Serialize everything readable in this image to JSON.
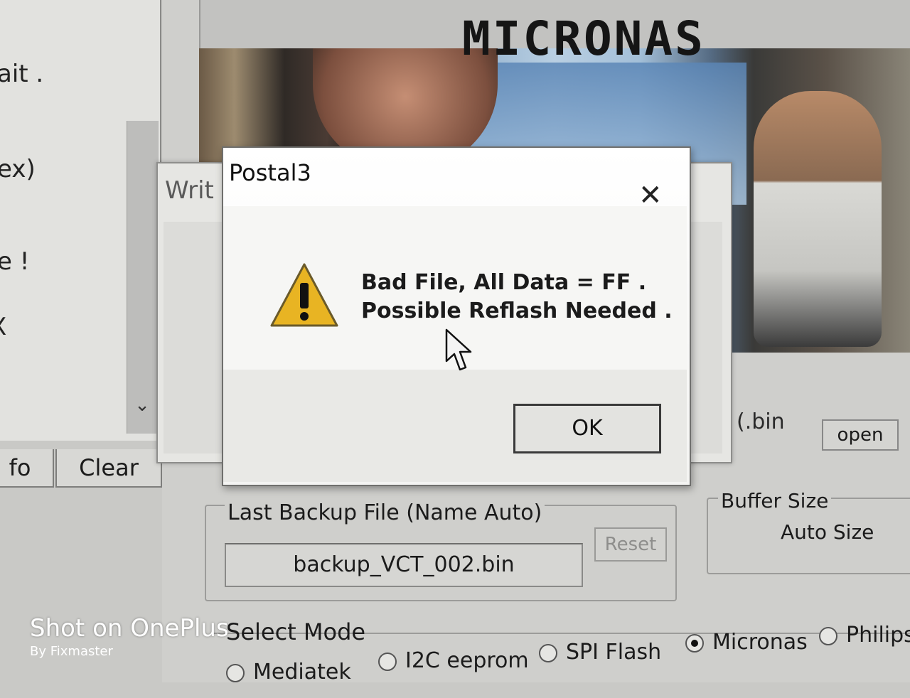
{
  "log_panel": {
    "lines": [
      "ait .",
      "ex)",
      "e !",
      "X"
    ],
    "scroll_down_glyph": "⌄",
    "info_button": "fo",
    "clear_button": "Clear"
  },
  "brand": {
    "title": "MICRONAS"
  },
  "file_row": {
    "filename_fragment": "(.bin",
    "open_button": "open"
  },
  "backup": {
    "legend": "Last Backup File (Name Auto)",
    "filename": "backup_VCT_002.bin",
    "reset_button": "Reset"
  },
  "buffer": {
    "legend": "Buffer Size",
    "value": "Auto Size"
  },
  "select_mode": {
    "legend": "Select Mode",
    "options": [
      {
        "label": "Mediatek",
        "selected": false
      },
      {
        "label": "I2C eeprom",
        "selected": false
      },
      {
        "label": "SPI Flash",
        "selected": false
      },
      {
        "label": "Micronas",
        "selected": true
      },
      {
        "label": "Philips",
        "selected": false
      }
    ]
  },
  "write_window": {
    "title": "Writ",
    "close_glyph": "✕"
  },
  "dialog": {
    "title": "Postal3",
    "close_glyph": "✕",
    "message_line_1": "Bad File, All Data = FF .",
    "message_line_2": "Possible Reflash Needed .",
    "ok_button": "OK",
    "icon": "warning-icon"
  },
  "watermark": {
    "main": "Shot on OnePlus",
    "sub": "By Fixmaster"
  }
}
